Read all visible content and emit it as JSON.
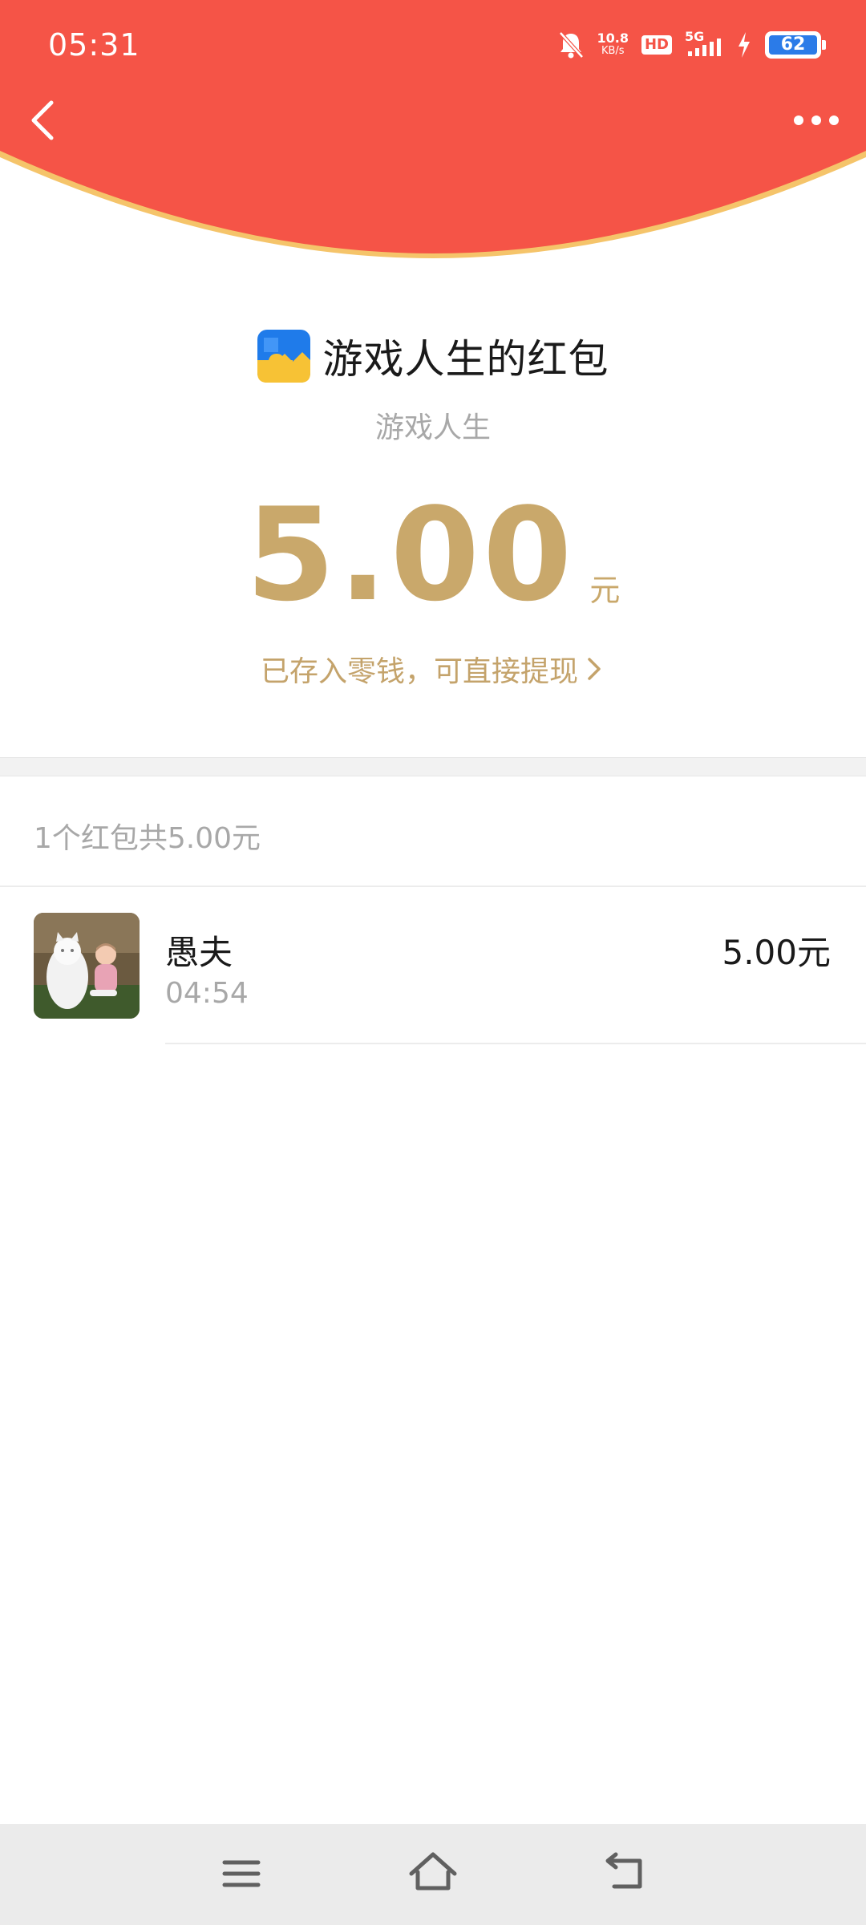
{
  "status_bar": {
    "time": "05:31",
    "net_speed_value": "10.8",
    "net_speed_unit": "KB/s",
    "hd_label": "HD",
    "signal_label": "5G",
    "battery_level": "62"
  },
  "header": {
    "color": "#f55447",
    "edge_color": "#f5c46a"
  },
  "envelope": {
    "title": "游戏人生的红包",
    "sender": "游戏人生",
    "amount": "5.00",
    "unit": "元",
    "stored_link": "已存入零钱，可直接提现",
    "accent_color": "#c9a86b"
  },
  "summary": {
    "text": "1个红包共5.00元"
  },
  "records": [
    {
      "name": "愚夫",
      "time": "04:54",
      "amount": "5.00元"
    }
  ],
  "icons": {
    "back": "back-arrow-icon",
    "more": "more-dots-icon",
    "app": "puzzle-app-icon",
    "chevron": "chevron-right-icon",
    "nav_menu": "menu-lines-icon",
    "nav_home": "home-icon",
    "nav_back": "return-icon"
  }
}
